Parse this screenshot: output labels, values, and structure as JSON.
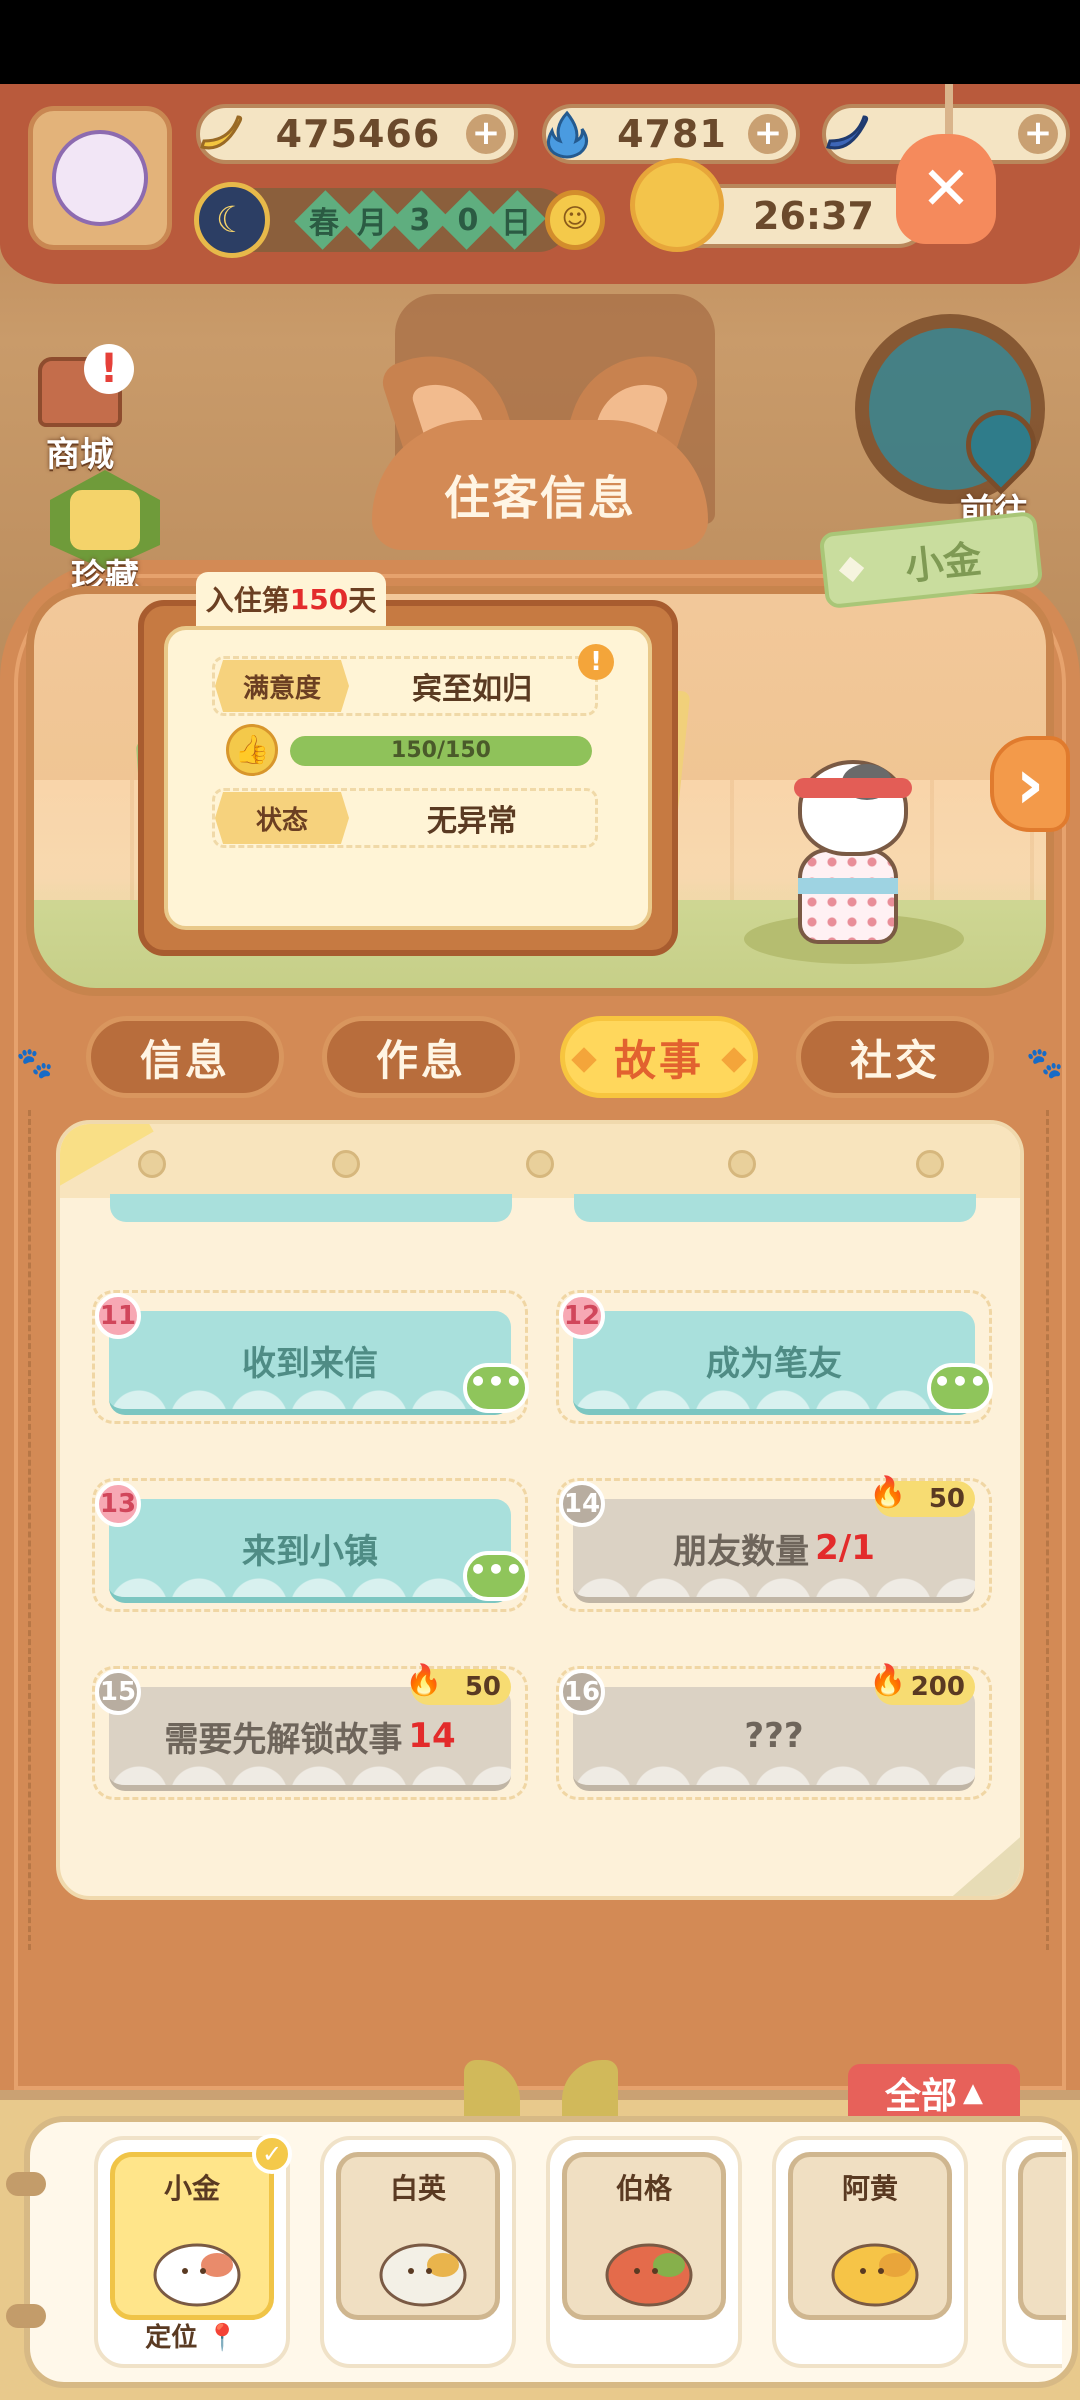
{
  "hud": {
    "banana_count": "475466",
    "flame_count": "4781",
    "third_count": "",
    "date_chars": [
      "春",
      "月",
      "3",
      "0",
      "日"
    ],
    "timer": "26:37"
  },
  "side": {
    "shop_label": "商城",
    "alert_mark": "!",
    "collection_label": "珍藏",
    "goto_label": "前往"
  },
  "panel": {
    "title": "住客信息",
    "guest_name": "小金",
    "stay_prefix": "入住第",
    "stay_days": "150",
    "stay_suffix": "天",
    "satisfaction_label": "满意度",
    "satisfaction_value": "宾至如归",
    "progress_text": "150/150",
    "progress_fraction": 1.0,
    "status_label": "状态",
    "status_value": "无异常"
  },
  "tabs": [
    {
      "label": "信息",
      "active": false
    },
    {
      "label": "作息",
      "active": false
    },
    {
      "label": "故事",
      "active": true
    },
    {
      "label": "社交",
      "active": false
    }
  ],
  "stories": [
    {
      "num": "11",
      "title": "收到来信",
      "state": "open",
      "cost": "",
      "highlight": ""
    },
    {
      "num": "12",
      "title": "成为笔友",
      "state": "open",
      "cost": "",
      "highlight": ""
    },
    {
      "num": "13",
      "title": "来到小镇",
      "state": "open",
      "cost": "",
      "highlight": ""
    },
    {
      "num": "14",
      "title": "朋友数量",
      "state": "lock",
      "cost": "50",
      "highlight": "2/1"
    },
    {
      "num": "15",
      "title": "需要先解锁故事",
      "state": "lock",
      "cost": "50",
      "highlight": "14"
    },
    {
      "num": "16",
      "title": "???",
      "state": "lock",
      "cost": "200",
      "highlight": ""
    }
  ],
  "roster": {
    "filter_label": "全部",
    "guests": [
      {
        "name": "小金",
        "selected": true,
        "locate": "定位"
      },
      {
        "name": "白英",
        "selected": false,
        "locate": ""
      },
      {
        "name": "伯格",
        "selected": false,
        "locate": ""
      },
      {
        "name": "阿黄",
        "selected": false,
        "locate": ""
      }
    ]
  },
  "colors": {
    "accent_red": "#e32b2b",
    "panel_orange": "#d38a55",
    "active_tab": "#ffd75c",
    "story_open": "#a9e0dc",
    "story_locked": "#dbd2c4"
  },
  "icons": [
    "banana-icon",
    "flame-icon",
    "blue-banana-icon",
    "moon-icon",
    "sun-icon",
    "close-icon",
    "shop-icon",
    "collection-gem-icon",
    "map-pin-icon",
    "thumbs-up-icon",
    "warning-icon",
    "chat-bubble-icon",
    "next-arrow-icon",
    "location-pin-icon",
    "checkmark-icon"
  ]
}
